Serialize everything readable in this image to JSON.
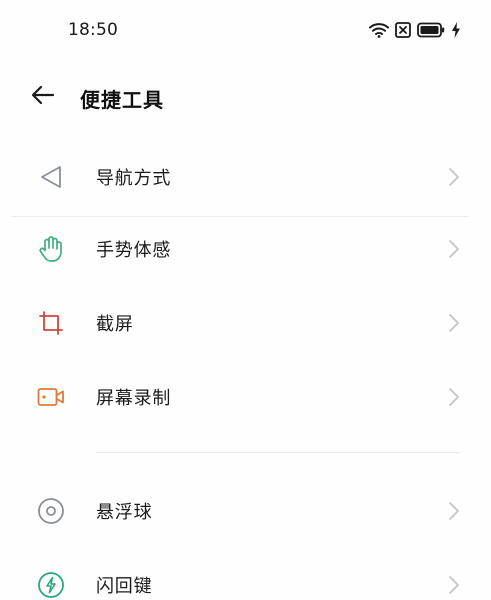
{
  "status_bar": {
    "time": "18:50",
    "icons": [
      "wifi-icon",
      "sim-off-icon",
      "battery-icon",
      "charging-icon"
    ]
  },
  "header": {
    "back_icon": "arrow-left-icon",
    "title": "便捷工具"
  },
  "list": {
    "items": [
      {
        "label": "导航方式",
        "icon": "navigation-icon",
        "icon_color": "#8a8f99"
      },
      {
        "label": "手势体感",
        "icon": "hand-gesture-icon",
        "icon_color": "#3fae7a"
      },
      {
        "label": "截屏",
        "icon": "crop-icon",
        "icon_color": "#d0463d"
      },
      {
        "label": "屏幕录制",
        "icon": "video-record-icon",
        "icon_color": "#e07a3a"
      },
      {
        "label": "悬浮球",
        "icon": "floating-ball-icon",
        "icon_color": "#8a8f99"
      },
      {
        "label": "闪回键",
        "icon": "flash-back-icon",
        "icon_color": "#2aa87a"
      }
    ],
    "chevron_icon": "chevron-right-icon"
  }
}
